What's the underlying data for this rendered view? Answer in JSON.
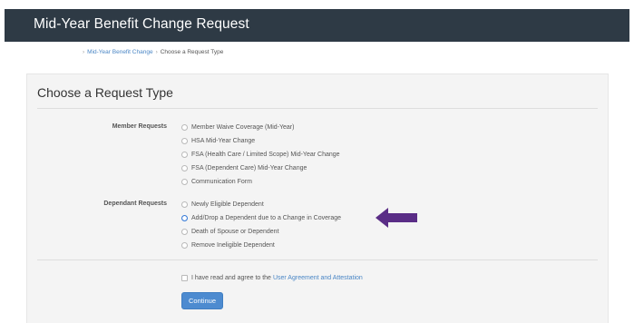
{
  "header": {
    "title": "Mid-Year Benefit Change Request"
  },
  "breadcrumb": {
    "parent": "Mid-Year Benefit Change",
    "separator": "›",
    "current": "Choose a Request Type"
  },
  "card": {
    "title": "Choose a Request Type"
  },
  "member_requests": {
    "label": "Member Requests",
    "options": [
      {
        "label": "Member Waive Coverage (Mid-Year)",
        "selected": false
      },
      {
        "label": "HSA Mid-Year Change",
        "selected": false
      },
      {
        "label": "FSA (Health Care / Limited Scope) Mid-Year Change",
        "selected": false
      },
      {
        "label": "FSA (Dependent Care) Mid-Year Change",
        "selected": false
      },
      {
        "label": "Communication Form",
        "selected": false
      }
    ]
  },
  "dependent_requests": {
    "label": "Dependant Requests",
    "options": [
      {
        "label": "Newly Eligible Dependent",
        "selected": false
      },
      {
        "label": "Add/Drop a Dependent due to a Change in Coverage",
        "selected": true
      },
      {
        "label": "Death of Spouse or Dependent",
        "selected": false
      },
      {
        "label": "Remove Ineligible Dependent",
        "selected": false
      }
    ]
  },
  "agreement": {
    "prefix": "I have read and agree to the",
    "link": "User Agreement and Attestation",
    "checked": false
  },
  "continue_label": "Continue",
  "colors": {
    "header_bg": "#2e3a45",
    "accent": "#4d8bd0",
    "arrow": "#5a2d86"
  },
  "annotation": {
    "arrow_icon": "left-arrow-icon"
  }
}
